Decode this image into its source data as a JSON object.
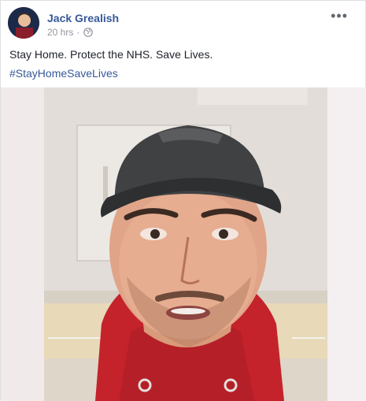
{
  "post": {
    "author": "Jack Grealish",
    "timestamp": "20 hrs",
    "separator": "·",
    "privacy_icon": "globe-icon",
    "more_label": "•••",
    "text": "Stay Home. Protect the NHS. Save Lives.",
    "hashtag": "#StayHomeSaveLives"
  },
  "colors": {
    "link_blue": "#365899",
    "meta_gray": "#90949c",
    "hoodie_red": "#c9252b"
  }
}
